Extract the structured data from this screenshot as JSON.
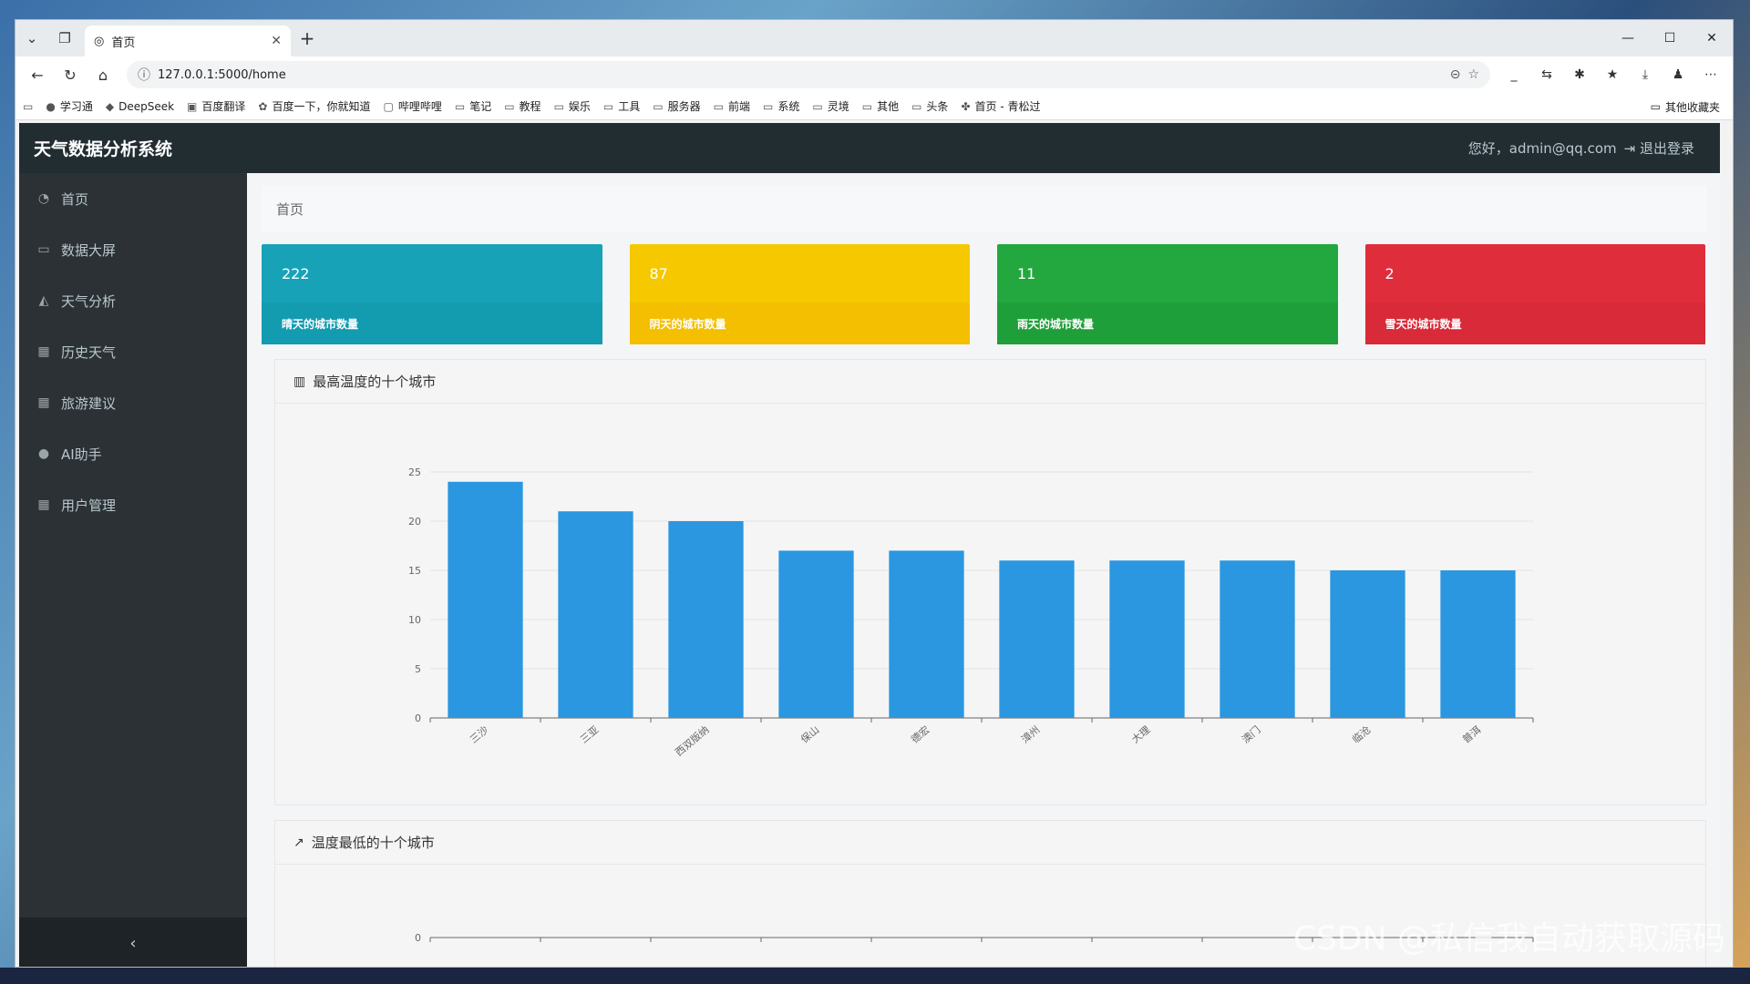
{
  "browser": {
    "tab_title": "首页",
    "url": "127.0.0.1:5000/home",
    "bookmarks": [
      "学习通",
      "DeepSeek",
      "百度翻译",
      "百度一下，你就知道",
      "哔哩哔哩",
      "笔记",
      "教程",
      "娱乐",
      "工具",
      "服务器",
      "前端",
      "系统",
      "灵境",
      "其他",
      "头条",
      "首页 - 青松过"
    ],
    "other_bookmarks": "其他收藏夹"
  },
  "app": {
    "brand": "天气数据分析系统",
    "greeting": "您好，admin@qq.com",
    "logout": "退出登录"
  },
  "sidebar": {
    "items": [
      {
        "label": "首页",
        "icon": "dashboard-icon"
      },
      {
        "label": "数据大屏",
        "icon": "monitor-icon"
      },
      {
        "label": "天气分析",
        "icon": "area-chart-icon"
      },
      {
        "label": "历史天气",
        "icon": "table-icon"
      },
      {
        "label": "旅游建议",
        "icon": "table-icon"
      },
      {
        "label": "AI助手",
        "icon": "chat-icon"
      },
      {
        "label": "用户管理",
        "icon": "table-icon"
      }
    ],
    "collapse": "‹"
  },
  "breadcrumb": "首页",
  "cards": [
    {
      "value": "222",
      "label": "晴天的城市数量",
      "color": "#17a2b8"
    },
    {
      "value": "87",
      "label": "阴天的城市数量",
      "color": "#f5c800"
    },
    {
      "value": "11",
      "label": "雨天的城市数量",
      "color": "#22a83e"
    },
    {
      "value": "2",
      "label": "雪天的城市数量",
      "color": "#e02d3c"
    }
  ],
  "panel1": {
    "title": "最高温度的十个城市"
  },
  "panel2": {
    "title": "温度最低的十个城市"
  },
  "chart_data": [
    {
      "type": "bar",
      "title": "最高温度的十个城市",
      "categories": [
        "三沙",
        "三亚",
        "西双版纳",
        "保山",
        "德宏",
        "漳州",
        "大理",
        "澳门",
        "临沧",
        "普洱"
      ],
      "values": [
        24,
        21,
        20,
        17,
        17,
        16,
        16,
        16,
        15,
        15
      ],
      "ylim": [
        0,
        25
      ],
      "yticks": [
        0,
        5,
        10,
        15,
        20,
        25
      ],
      "color": "#2a97e0",
      "grid": true
    },
    {
      "type": "bar",
      "title": "温度最低的十个城市",
      "yticks": [
        0
      ]
    }
  ],
  "watermark": "CSDN @私信我自动获取源码"
}
